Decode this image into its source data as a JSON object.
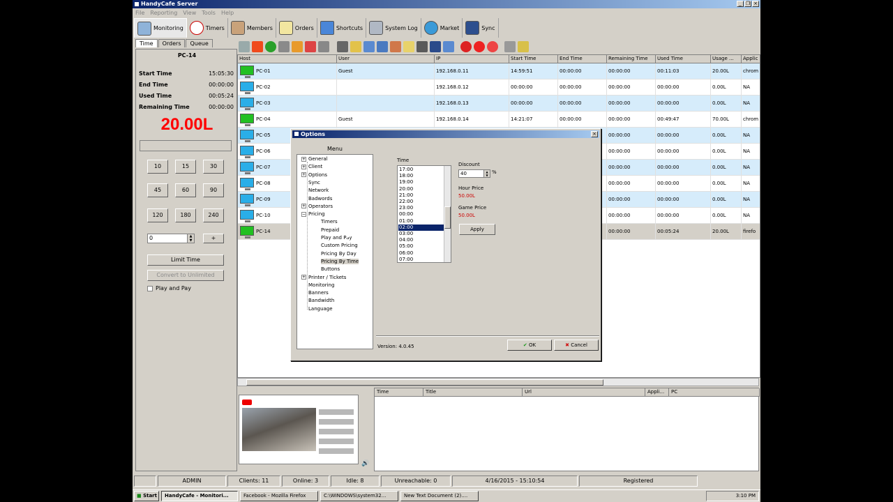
{
  "window": {
    "title": "HandyCafe Server"
  },
  "menu": [
    "File",
    "Reporting",
    "View",
    "Tools",
    "Help"
  ],
  "nav_tabs": [
    "Monitoring",
    "Timers",
    "Members",
    "Orders",
    "Shortcuts",
    "System Log",
    "Market",
    "Sync"
  ],
  "left_tabs": [
    "Time",
    "Orders",
    "Queue"
  ],
  "left": {
    "pc": "PC-14",
    "start_time_label": "Start Time",
    "start_time": "15:05:30",
    "end_time_label": "End Time",
    "end_time": "00:00:00",
    "used_time_label": "Used Time",
    "used_time": "00:05:24",
    "remaining_time_label": "Remaining Time",
    "remaining_time": "00:00:00",
    "balance": "20.00L",
    "minute_buttons": [
      "10",
      "15",
      "30",
      "45",
      "60",
      "90",
      "120",
      "180",
      "240"
    ],
    "spin_value": "0",
    "plus": "+",
    "limit_time": "Limit Time",
    "convert_unlimited": "Convert to Unlimited",
    "play_and_pay": "Play and Pay"
  },
  "grid": {
    "headers": [
      "Host",
      "User",
      "IP",
      "Start Time",
      "End Time",
      "Remaining Time",
      "Used Time",
      "Usage ...",
      "Applic"
    ],
    "rows": [
      {
        "host": "PC-01",
        "user": "Guest",
        "ip": "192.168.0.11",
        "start": "14:59:51",
        "end": "00:00:00",
        "remain": "00:00:00",
        "used": "00:11:03",
        "usage": "20.00L",
        "app": "chrom",
        "status": "green"
      },
      {
        "host": "PC-02",
        "user": "",
        "ip": "192.168.0.12",
        "start": "00:00:00",
        "end": "00:00:00",
        "remain": "00:00:00",
        "used": "00:00:00",
        "usage": "0.00L",
        "app": "NA",
        "status": "blue"
      },
      {
        "host": "PC-03",
        "user": "",
        "ip": "192.168.0.13",
        "start": "00:00:00",
        "end": "00:00:00",
        "remain": "00:00:00",
        "used": "00:00:00",
        "usage": "0.00L",
        "app": "NA",
        "status": "blue"
      },
      {
        "host": "PC-04",
        "user": "Guest",
        "ip": "192.168.0.14",
        "start": "14:21:07",
        "end": "00:00:00",
        "remain": "00:00:00",
        "used": "00:49:47",
        "usage": "70.00L",
        "app": "chrom",
        "status": "green"
      },
      {
        "host": "PC-05",
        "user": "",
        "ip": "",
        "start": "",
        "end": "",
        "remain": "00:00:00",
        "used": "00:00:00",
        "usage": "0.00L",
        "app": "NA",
        "status": "blue"
      },
      {
        "host": "PC-06",
        "user": "",
        "ip": "",
        "start": "",
        "end": "",
        "remain": "00:00:00",
        "used": "00:00:00",
        "usage": "0.00L",
        "app": "NA",
        "status": "blue"
      },
      {
        "host": "PC-07",
        "user": "",
        "ip": "",
        "start": "",
        "end": "",
        "remain": "00:00:00",
        "used": "00:00:00",
        "usage": "0.00L",
        "app": "NA",
        "status": "blue"
      },
      {
        "host": "PC-08",
        "user": "",
        "ip": "",
        "start": "",
        "end": "",
        "remain": "00:00:00",
        "used": "00:00:00",
        "usage": "0.00L",
        "app": "NA",
        "status": "blue"
      },
      {
        "host": "PC-09",
        "user": "",
        "ip": "",
        "start": "",
        "end": "",
        "remain": "00:00:00",
        "used": "00:00:00",
        "usage": "0.00L",
        "app": "NA",
        "status": "blue"
      },
      {
        "host": "PC-10",
        "user": "",
        "ip": "",
        "start": "",
        "end": "",
        "remain": "00:00:00",
        "used": "00:00:00",
        "usage": "0.00L",
        "app": "NA",
        "status": "blue"
      },
      {
        "host": "PC-14",
        "user": "",
        "ip": "",
        "start": "",
        "end": "",
        "remain": "00:00:00",
        "used": "00:05:24",
        "usage": "20.00L",
        "app": "firefo",
        "status": "green"
      }
    ]
  },
  "web_headers": [
    "Time",
    "Title",
    "Url",
    "Appli...",
    "PC"
  ],
  "status": {
    "user": "ADMIN",
    "clients": "Clients: 11",
    "online": "Online: 3",
    "idle": "Idle: 8",
    "unreachable": "Unreachable: 0",
    "datetime": "4/16/2015 - 15:10:54",
    "registered": "Registered"
  },
  "options": {
    "title": "Options",
    "menu_label": "Menu",
    "tree": [
      {
        "label": "General",
        "level": 0,
        "exp": true
      },
      {
        "label": "Client",
        "level": 0,
        "exp": true
      },
      {
        "label": "Options",
        "level": 0,
        "exp": true
      },
      {
        "label": "Sync",
        "level": 0,
        "exp": false
      },
      {
        "label": "Network",
        "level": 0,
        "exp": false
      },
      {
        "label": "Badwords",
        "level": 0,
        "exp": false
      },
      {
        "label": "Operators",
        "level": 0,
        "exp": true
      },
      {
        "label": "Pricing",
        "level": 0,
        "exp": true,
        "open": true
      },
      {
        "label": "Timers",
        "level": 1
      },
      {
        "label": "Prepaid",
        "level": 1
      },
      {
        "label": "Play and Pay",
        "level": 1
      },
      {
        "label": "Custom Pricing",
        "level": 1
      },
      {
        "label": "Pricing By Day",
        "level": 1
      },
      {
        "label": "Pricing By Time",
        "level": 1,
        "selected": true
      },
      {
        "label": "Buttons",
        "level": 1
      },
      {
        "label": "Printer / Tickets",
        "level": 0,
        "exp": true
      },
      {
        "label": "Monitoring",
        "level": 0,
        "exp": false
      },
      {
        "label": "Banners",
        "level": 0,
        "exp": false
      },
      {
        "label": "Bandwidth",
        "level": 0,
        "exp": false
      },
      {
        "label": "Language",
        "level": 0,
        "exp": false
      }
    ],
    "time_label": "Time",
    "times": [
      "17:00",
      "18:00",
      "19:00",
      "20:00",
      "21:00",
      "22:00",
      "23:00",
      "00:00",
      "01:00",
      "02:00",
      "03:00",
      "04:00",
      "05:00",
      "06:00",
      "07:00"
    ],
    "selected_time": "02:00",
    "discount_label": "Discount",
    "discount": "40",
    "percent": "%",
    "hour_price_label": "Hour Price",
    "hour_price": "50.00L",
    "game_price_label": "Game Price",
    "game_price": "50.00L",
    "apply": "Apply",
    "version": "Version: 4.0.45",
    "ok": "OK",
    "cancel": "Cancel"
  },
  "taskbar": {
    "start": "Start",
    "items": [
      "HandyCafe - Monitori...",
      "Facebook - Mozilla Firefox",
      "C:\\WINDOWS\\system32...",
      "New Text Document (2)...."
    ],
    "clock": "3:10 PM"
  },
  "colors": {
    "accent": "#0a246a",
    "row_highlight": "#d6ecfb",
    "selected_row": "#d4d0c8",
    "balance": "#ff0000",
    "online": "#22c022",
    "offline": "#2aaee8"
  },
  "icons": [
    "play-icon",
    "stop-icon",
    "check-icon",
    "forward-icon",
    "refresh-icon",
    "close-circle-icon",
    "power-icon"
  ]
}
